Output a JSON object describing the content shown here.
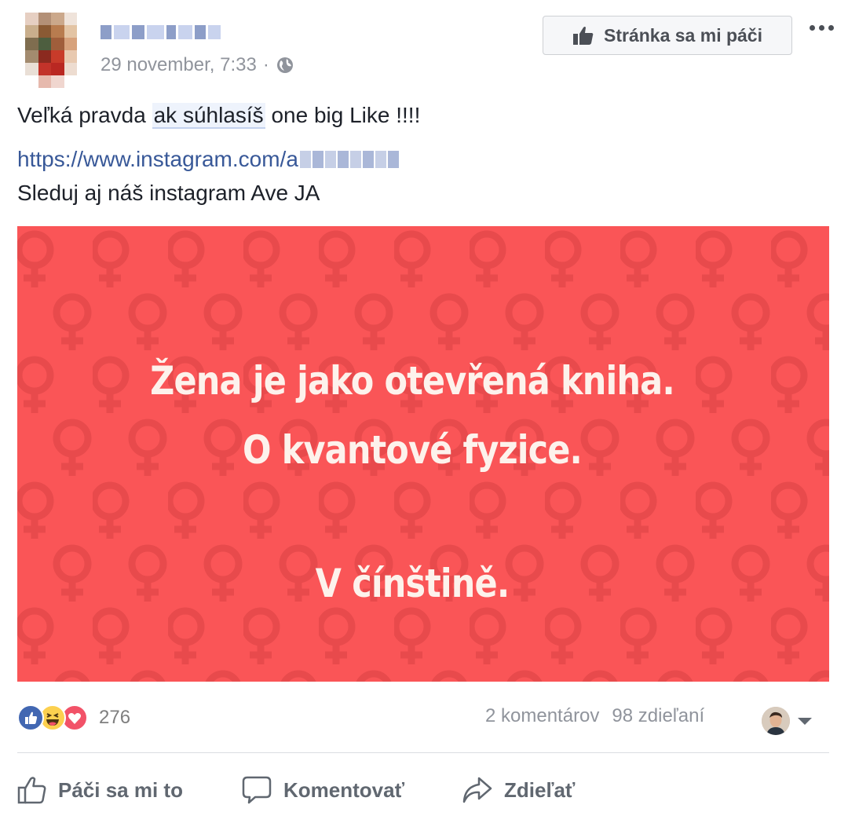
{
  "post": {
    "timestamp": "29 november, 7:33",
    "meta_separator": "·",
    "privacy_icon": "globe-icon",
    "text_before": "Veľká pravda ",
    "text_highlight": "ak súhlasíš",
    "text_after": " one big Like !!!!",
    "link_visible": "https://www.instagram.com/a",
    "subtext": "Sleduj aj náš instagram Ave JA"
  },
  "header": {
    "like_page_label": "Stránka sa mi páči",
    "like_page_icon": "thumbs-up-icon",
    "more_icon": "more-options-icon"
  },
  "image": {
    "line1": "Žena je jako otevřená kniha.",
    "line2": "O kvantové fyzice.",
    "line3": "V čínštině.",
    "background_color": "#fa5557"
  },
  "engagement": {
    "reaction_icons": [
      "like-reaction-icon",
      "haha-reaction-icon",
      "love-reaction-icon"
    ],
    "reaction_count": "276",
    "comments": "2 komentárov",
    "shares": "98 zdieľaní"
  },
  "actions": {
    "like": "Páči sa mi to",
    "comment": "Komentovať",
    "share": "Zdieľať"
  },
  "colors": {
    "link": "#385898",
    "muted": "#90949c",
    "like_blue": "#4267b2",
    "love_red": "#f25268",
    "haha_yellow": "#fcd04f"
  }
}
